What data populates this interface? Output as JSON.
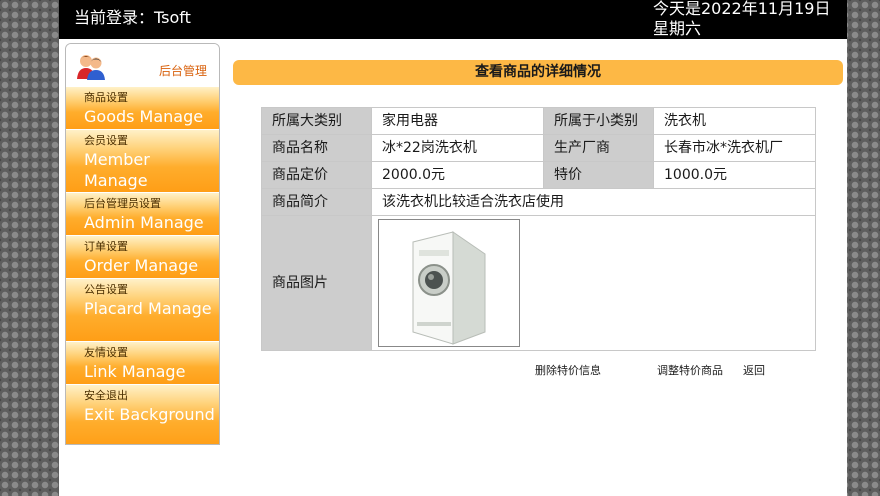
{
  "header": {
    "login": "当前登录：Tsoft",
    "date": "今天是2022年11月19日 星期六"
  },
  "sidebar": {
    "title": "后台管理",
    "items": [
      {
        "cn": "商品设置",
        "en": "Goods Manage"
      },
      {
        "cn": "会员设置",
        "en": "Member Manage"
      },
      {
        "cn": "后台管理员设置",
        "en": "Admin Manage"
      },
      {
        "cn": "订单设置",
        "en": "Order Manage"
      },
      {
        "cn": "公告设置",
        "en": "Placard Manage"
      },
      {
        "cn": "友情设置",
        "en": "Link Manage"
      },
      {
        "cn": "安全退出",
        "en": "Exit Background"
      }
    ]
  },
  "main": {
    "title": "查看商品的详细情况",
    "table": {
      "big_category_label": "所属大类别",
      "big_category_value": "家用电器",
      "small_category_label": "所属于小类别",
      "small_category_value": "洗衣机",
      "name_label": "商品名称",
      "name_value": "冰*22岗洗衣机",
      "manufacturer_label": "生产厂商",
      "manufacturer_value": "长春市冰*洗衣机厂",
      "price_label": "商品定价",
      "price_value": "2000.0元",
      "special_label": "特价",
      "special_value": "1000.0元",
      "intro_label": "商品简介",
      "intro_value": "该洗衣机比较适合洗衣店使用",
      "image_label": "商品图片"
    },
    "actions": {
      "delete_special": "删除特价信息",
      "adjust_special": "调整特价商品",
      "back": "返回"
    }
  }
}
